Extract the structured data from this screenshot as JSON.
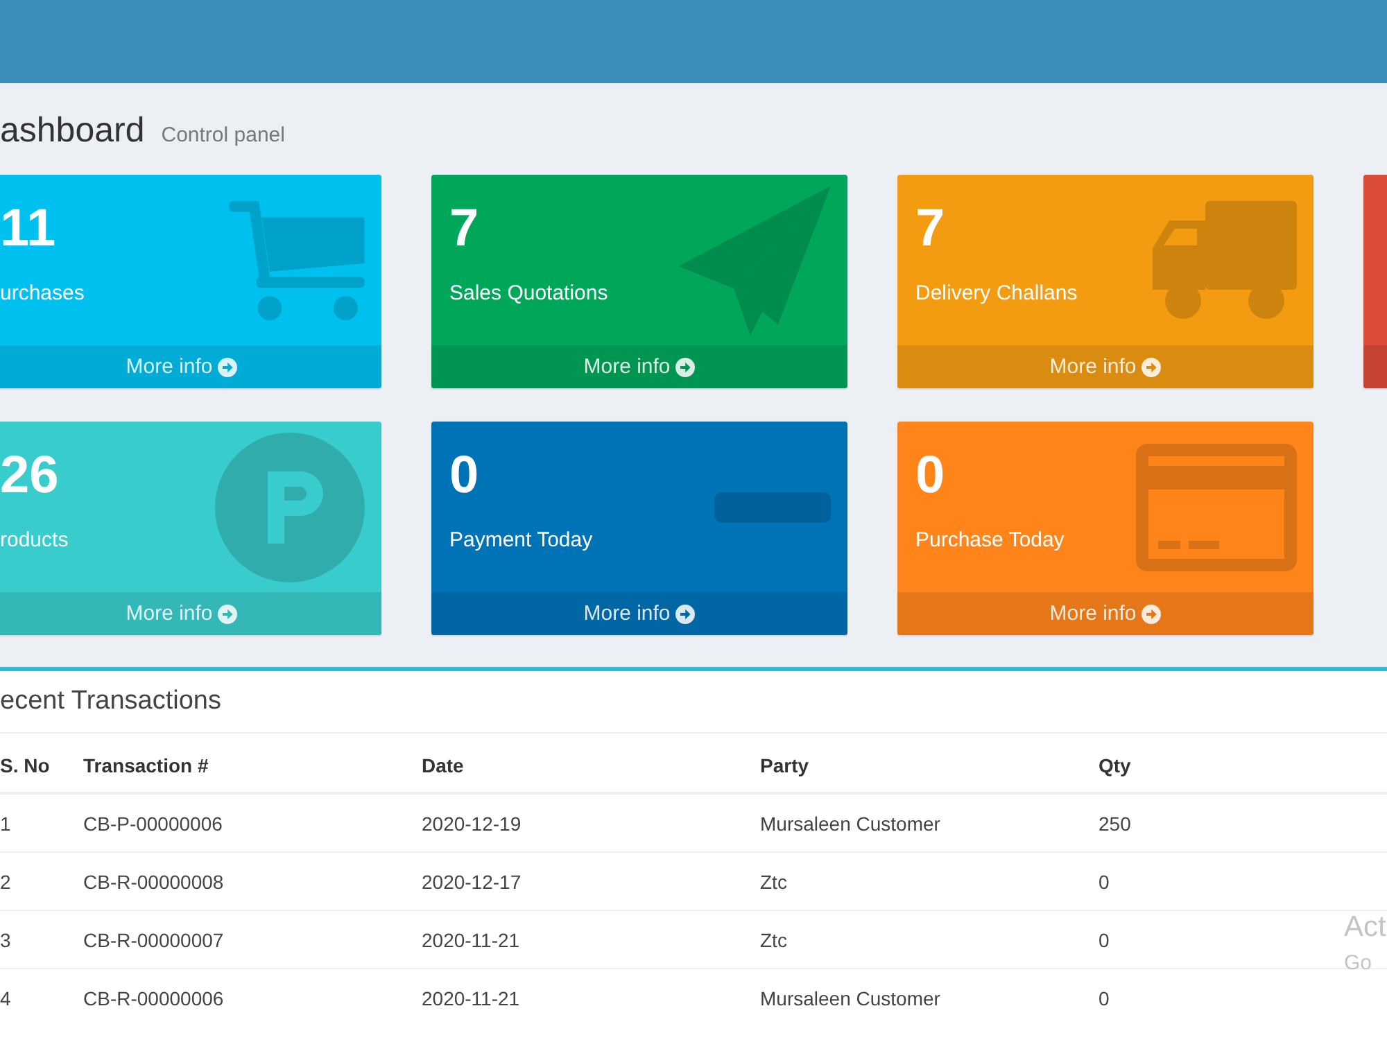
{
  "page": {
    "title": "ashboard",
    "subtitle": "Control panel"
  },
  "card_rows": [
    {
      "cards": [
        {
          "value": "11",
          "label": "urchases",
          "link": "More info",
          "color": "#00c0ef"
        },
        {
          "value": "7",
          "label": "Sales Quotations",
          "link": "More info",
          "color": "#00a65a"
        },
        {
          "value": "7",
          "label": "Delivery Challans",
          "link": "More info",
          "color": "#f39c12"
        },
        {
          "color": "#dd4b39"
        }
      ]
    },
    {
      "cards": [
        {
          "value": "26",
          "label": "roducts",
          "link": "More info",
          "color": "#39cccc"
        },
        {
          "value": "0",
          "label": "Payment Today",
          "link": "More info",
          "color": "#0073b7"
        },
        {
          "value": "0",
          "label": "Purchase Today",
          "link": "More info",
          "color": "#ff851b"
        }
      ]
    }
  ],
  "recent_transactions": {
    "title": "ecent Transactions",
    "columns": [
      "S. No",
      "Transaction #",
      "Date",
      "Party",
      "Qty"
    ],
    "rows": [
      [
        "1",
        "CB-P-00000006",
        "2020-12-19",
        "Mursaleen Customer",
        "250"
      ],
      [
        "2",
        "CB-R-00000008",
        "2020-12-17",
        "Ztc",
        "0"
      ],
      [
        "3",
        "CB-R-00000007",
        "2020-11-21",
        "Ztc",
        "0"
      ],
      [
        "4",
        "CB-R-00000006",
        "2020-11-21",
        "Mursaleen Customer",
        "0"
      ]
    ]
  },
  "activation_notice": {
    "title": "Act",
    "subtitle": "Go"
  }
}
